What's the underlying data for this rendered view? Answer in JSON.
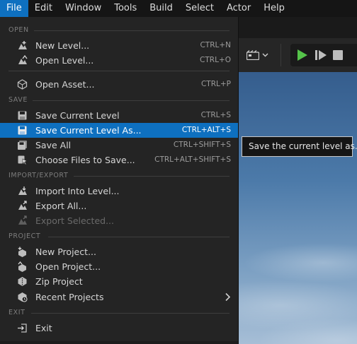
{
  "menubar": {
    "items": [
      "File",
      "Edit",
      "Window",
      "Tools",
      "Build",
      "Select",
      "Actor",
      "Help"
    ]
  },
  "file_menu": {
    "sections": {
      "open": "OPEN",
      "save": "SAVE",
      "import_export": "IMPORT/EXPORT",
      "project": "PROJECT",
      "exit": "EXIT"
    },
    "items": {
      "new_level": {
        "label": "New Level...",
        "shortcut": "CTRL+N"
      },
      "open_level": {
        "label": "Open Level...",
        "shortcut": "CTRL+O"
      },
      "open_asset": {
        "label": "Open Asset...",
        "shortcut": "CTRL+P"
      },
      "save_current_level": {
        "label": "Save Current Level",
        "shortcut": "CTRL+S"
      },
      "save_current_level_as": {
        "label": "Save Current Level As...",
        "shortcut": "CTRL+ALT+S"
      },
      "save_all": {
        "label": "Save All",
        "shortcut": "CTRL+SHIFT+S"
      },
      "choose_files_to_save": {
        "label": "Choose Files to Save...",
        "shortcut": "CTRL+ALT+SHIFT+S"
      },
      "import_into_level": {
        "label": "Import Into Level..."
      },
      "export_all": {
        "label": "Export All..."
      },
      "export_selected": {
        "label": "Export Selected..."
      },
      "new_project": {
        "label": "New Project..."
      },
      "open_project": {
        "label": "Open Project..."
      },
      "zip_project": {
        "label": "Zip Project"
      },
      "recent_projects": {
        "label": "Recent Projects"
      },
      "exit": {
        "label": "Exit"
      }
    }
  },
  "tooltip": {
    "text": "Save the current level as..."
  },
  "colors": {
    "accent": "#0e70c0",
    "menu_bg": "#242424",
    "play_green": "#55c44a"
  },
  "icons": [
    "new-level-icon",
    "open-level-icon",
    "open-asset-icon",
    "save-icon",
    "save-as-icon",
    "save-all-icon",
    "choose-files-icon",
    "import-icon",
    "export-icon",
    "new-project-icon",
    "open-project-icon",
    "zip-icon",
    "recent-projects-icon",
    "exit-icon",
    "camera-icon",
    "play-icon",
    "skip-icon",
    "stop-icon",
    "chevron-right-icon"
  ]
}
